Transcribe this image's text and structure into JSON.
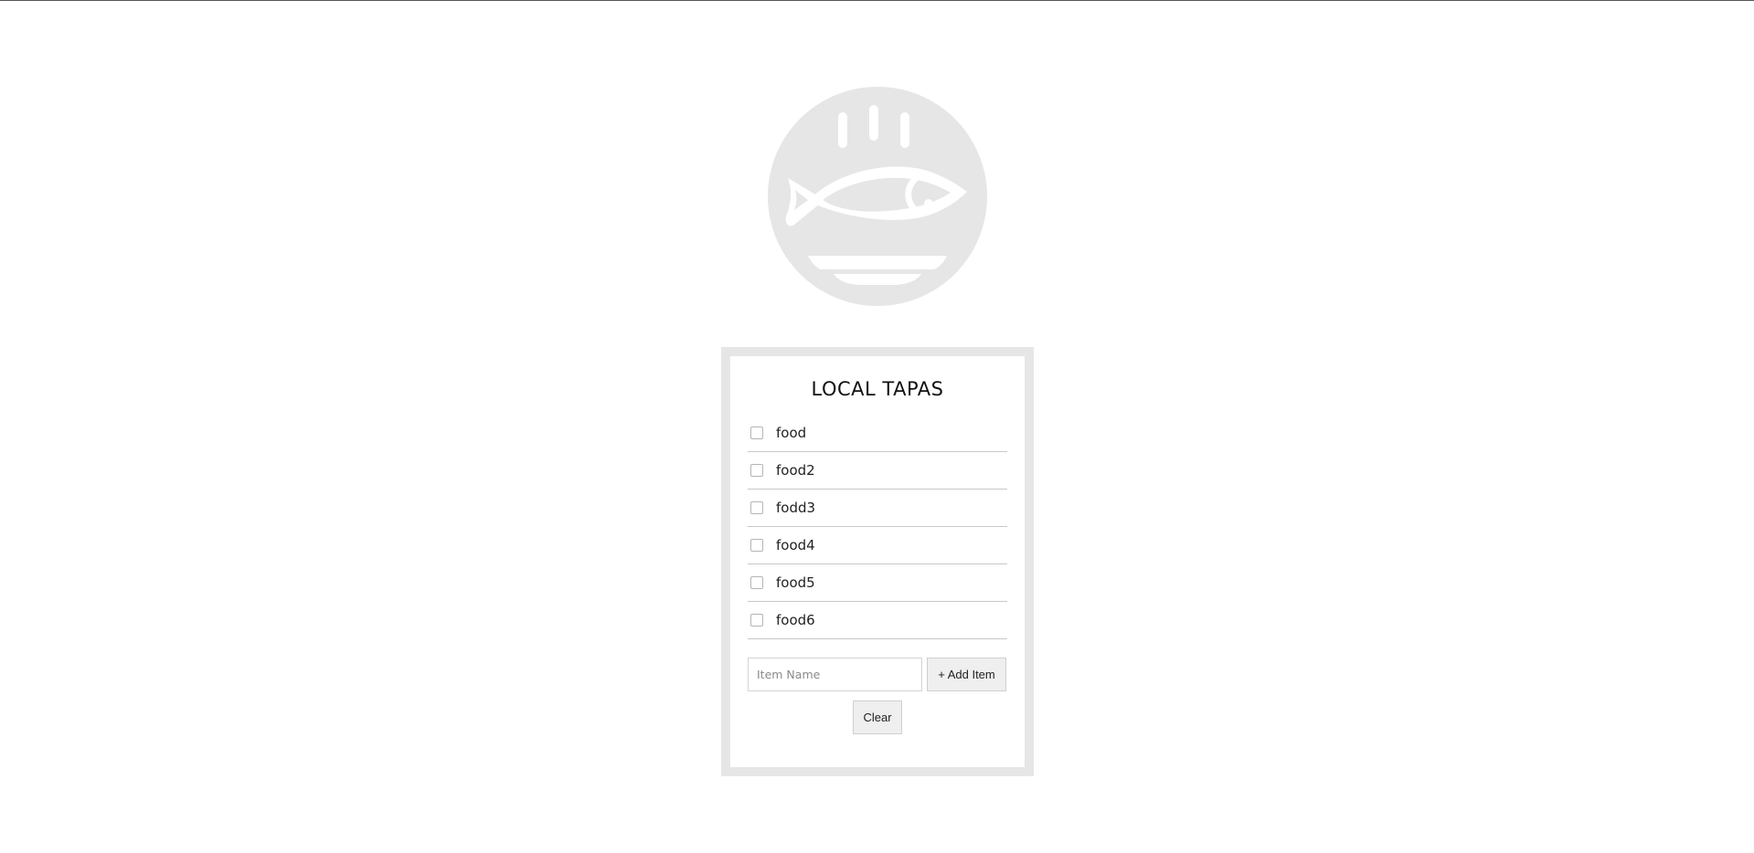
{
  "app": {
    "title": "LOCAL TAPAS",
    "logo_icon": "fish-on-plate-icon"
  },
  "colors": {
    "logo_circle": "#e6e6e6",
    "card_border": "#e6e6e6",
    "button_bg": "#efefef"
  },
  "items": [
    {
      "label": "food",
      "checked": false
    },
    {
      "label": "food2",
      "checked": false
    },
    {
      "label": "fodd3",
      "checked": false
    },
    {
      "label": "food4",
      "checked": false
    },
    {
      "label": "food5",
      "checked": false
    },
    {
      "label": "food6",
      "checked": false
    }
  ],
  "form": {
    "input_placeholder": "Item Name",
    "input_value": "",
    "add_label": "+ Add Item",
    "clear_label": "Clear"
  }
}
